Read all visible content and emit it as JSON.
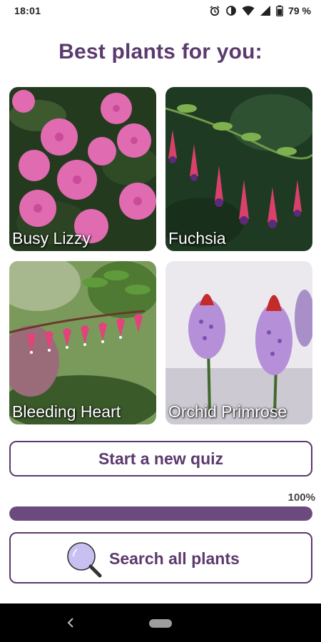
{
  "status_bar": {
    "time": "18:01",
    "battery_text": "79 %",
    "icons": [
      "alarm-icon",
      "data-saver-icon",
      "wifi-icon",
      "signal-icon",
      "battery-icon"
    ]
  },
  "title": "Best plants for you:",
  "plants": [
    {
      "name": "Busy Lizzy"
    },
    {
      "name": "Fuchsia"
    },
    {
      "name": "Bleeding Heart"
    },
    {
      "name": "Orchid Primrose"
    }
  ],
  "quiz_button": {
    "label": "Start a new quiz"
  },
  "progress": {
    "label": "100%",
    "value": 1.0
  },
  "search_button": {
    "label": "Search all plants",
    "icon": "search-icon"
  },
  "nav": {
    "icons": [
      "back-icon",
      "home-pill-icon"
    ]
  },
  "colors": {
    "accent": "#5b3a6e",
    "progress_fill": "#6b4a7d",
    "progress_track": "#e6dcef",
    "search_icon_fill": "#c9c0f2"
  }
}
